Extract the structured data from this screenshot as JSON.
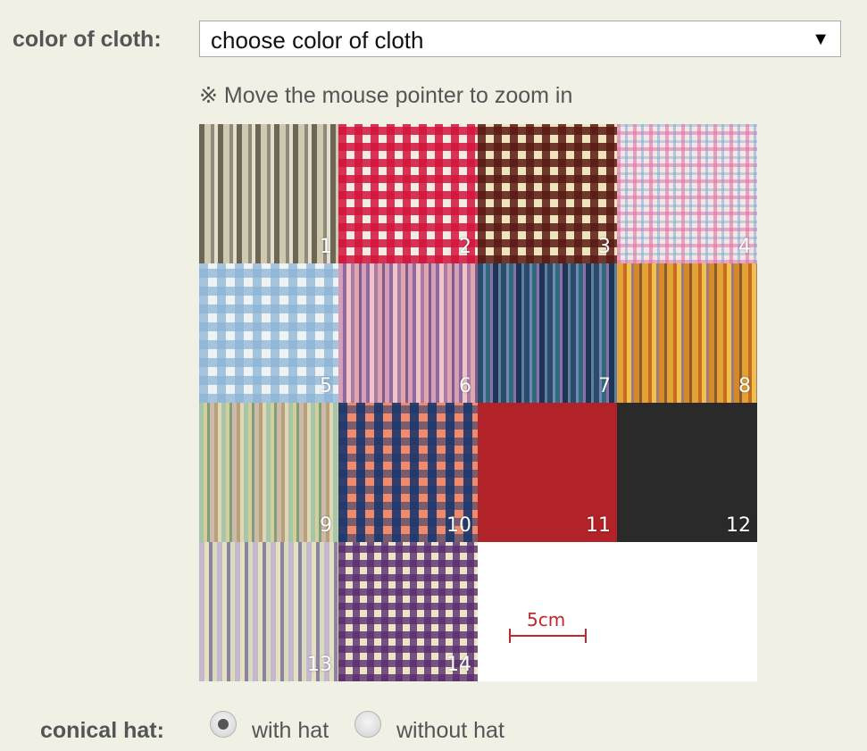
{
  "color_field": {
    "label": "color of cloth:",
    "selected": "choose color of cloth",
    "arrow": "▼"
  },
  "hint": "※ Move the mouse pointer to zoom in",
  "swatches": [
    {
      "number": "1"
    },
    {
      "number": "2"
    },
    {
      "number": "3"
    },
    {
      "number": "4"
    },
    {
      "number": "5"
    },
    {
      "number": "6"
    },
    {
      "number": "7"
    },
    {
      "number": "8"
    },
    {
      "number": "9"
    },
    {
      "number": "10"
    },
    {
      "number": "11"
    },
    {
      "number": "12"
    },
    {
      "number": "13"
    },
    {
      "number": "14"
    }
  ],
  "scale": {
    "label": "5cm",
    "color": "#c0282c"
  },
  "hat_field": {
    "label": "conical hat:",
    "options": [
      {
        "label": "with hat",
        "selected": true
      },
      {
        "label": "without hat",
        "selected": false
      }
    ]
  },
  "colors": {
    "background": "#f1f0e5",
    "label_text": "#555555"
  }
}
